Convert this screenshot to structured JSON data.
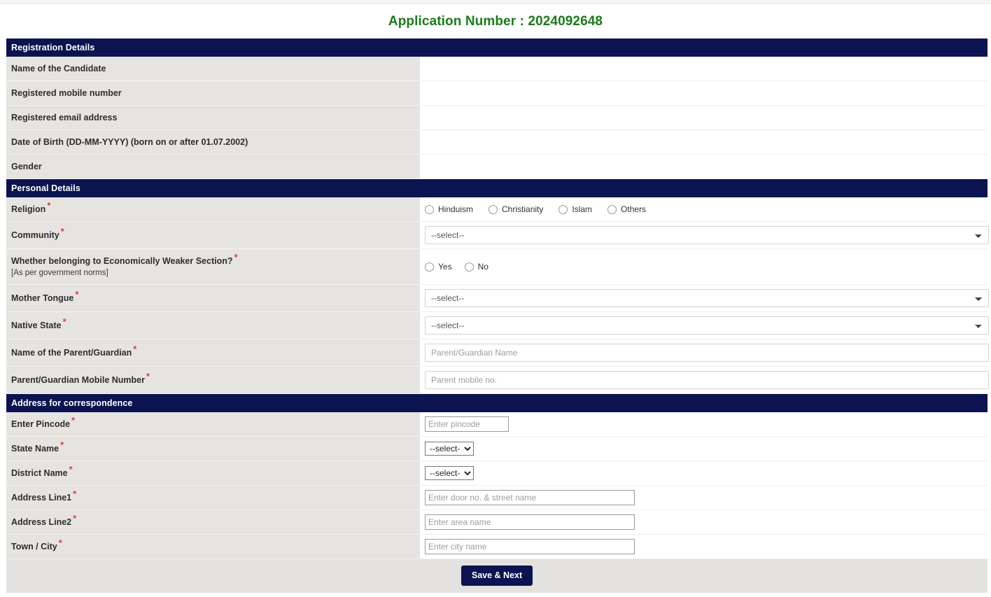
{
  "page": {
    "title_prefix": "Application Number :",
    "application_number": "2024092648",
    "title_full": "Application Number : 2024092648",
    "accent_green": "#1a7b1a",
    "section_navy": "#0b1450",
    "label_bg": "#e6e4e1",
    "required_mark": "*"
  },
  "sections": {
    "registration": {
      "heading": "Registration Details",
      "rows": [
        {
          "label": "Name of the Candidate",
          "value": ""
        },
        {
          "label": "Registered mobile number",
          "value": ""
        },
        {
          "label": "Registered email address",
          "value": ""
        },
        {
          "label": "Date of Birth (DD-MM-YYYY) (born on or after 01.07.2002)",
          "value": ""
        },
        {
          "label": "Gender",
          "value": ""
        }
      ]
    },
    "personal": {
      "heading": "Personal Details",
      "religion": {
        "label": "Religion",
        "options": [
          "Hinduism",
          "Christianity",
          "Islam",
          "Others"
        ],
        "selected": ""
      },
      "community": {
        "label": "Community",
        "selected": "--select--",
        "options": [
          "--select--"
        ]
      },
      "ews": {
        "label": "Whether belonging to Economically Weaker Section?",
        "note": "[As per government norms]",
        "options": [
          "Yes",
          "No"
        ],
        "selected": ""
      },
      "mother_tongue": {
        "label": "Mother Tongue",
        "selected": "--select--",
        "options": [
          "--select--"
        ]
      },
      "native_state": {
        "label": "Native State",
        "selected": "--select--",
        "options": [
          "--select--"
        ]
      },
      "parent_name": {
        "label": "Name of the Parent/Guardian",
        "value": "",
        "placeholder": "Parent/Guardian Name"
      },
      "parent_mobile": {
        "label": "Parent/Guardian Mobile Number",
        "value": "",
        "placeholder": "Parent mobile no."
      }
    },
    "address": {
      "heading": "Address for correspondence",
      "pincode": {
        "label": "Enter Pincode",
        "value": "",
        "placeholder": "Enter pincode"
      },
      "state": {
        "label": "State Name",
        "selected": "--select--",
        "options": [
          "--select--"
        ]
      },
      "district": {
        "label": "District Name",
        "selected": "--select--",
        "options": [
          "--select--"
        ]
      },
      "line1": {
        "label": "Address Line1",
        "value": "",
        "placeholder": "Enter door no. & street name"
      },
      "line2": {
        "label": "Address Line2",
        "value": "",
        "placeholder": "Enter area name"
      },
      "town": {
        "label": "Town / City",
        "value": "",
        "placeholder": "Enter city name"
      }
    }
  },
  "footer": {
    "save_label": "Save & Next"
  }
}
